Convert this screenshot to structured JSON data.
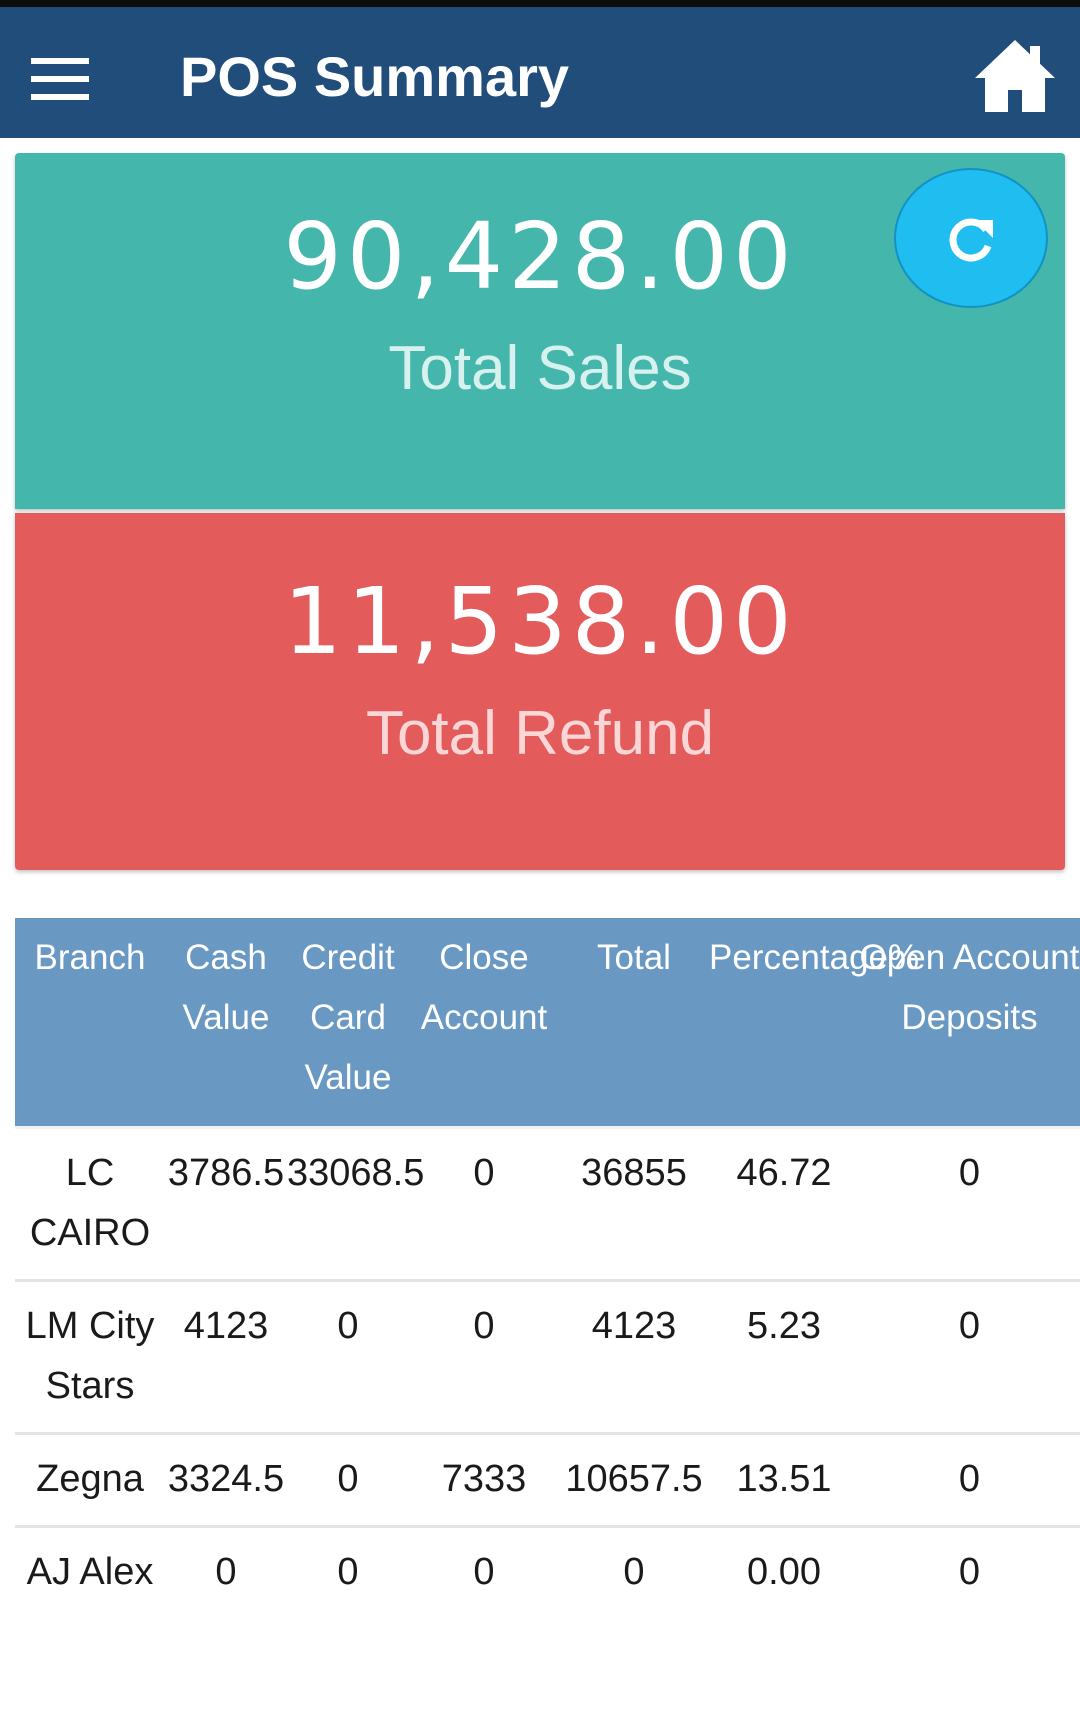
{
  "app_bar": {
    "title": "POS Summary",
    "menu_icon": "hamburger-menu-icon",
    "home_icon": "home-icon"
  },
  "refresh": {
    "icon": "refresh-icon"
  },
  "cards": {
    "sales": {
      "value": "90,428.00",
      "label": "Total Sales"
    },
    "refund": {
      "value": "11,538.00",
      "label": "Total Refund"
    }
  },
  "table": {
    "headers": [
      "Branch",
      "Cash Value",
      "Credit Card Value",
      "Close Account",
      "Total",
      "Percentage%",
      "Open Account Deposits"
    ],
    "rows": [
      [
        "LC CAIRO",
        "3786.5",
        "33068.5",
        "0",
        "36855",
        "46.72",
        "0"
      ],
      [
        "LM City Stars",
        "4123",
        "0",
        "0",
        "4123",
        "5.23",
        "0"
      ],
      [
        "Zegna",
        "3324.5",
        "0",
        "7333",
        "10657.5",
        "13.51",
        "0"
      ],
      [
        "AJ Alex",
        "0",
        "0",
        "0",
        "0",
        "0.00",
        "0"
      ]
    ]
  },
  "colors": {
    "app_bar": "#204d79",
    "sales_card": "#45b6ac",
    "refund_card": "#e35b5b",
    "refresh_button": "#1fbdf0",
    "table_header": "#6998c3"
  }
}
